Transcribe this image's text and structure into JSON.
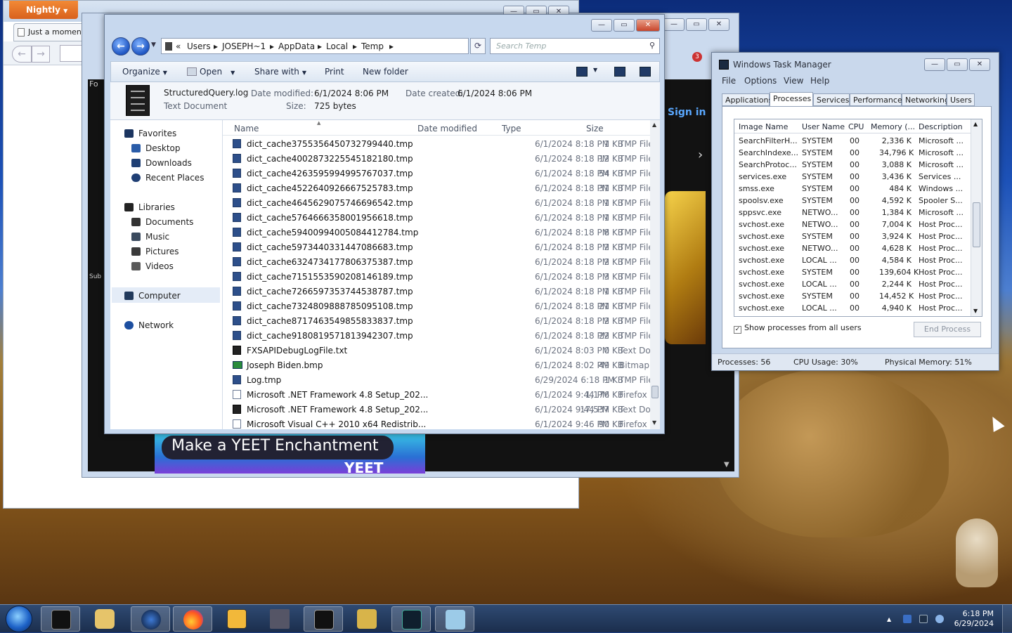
{
  "firefox": {
    "menu_button": "Nightly",
    "tab_title": "Just a moment..."
  },
  "browser": {
    "sign_in": "Sign in",
    "notification_count": "3",
    "promo_text": "Make a YEET Enchantment",
    "promo_logo": "YEET",
    "side_text_fo": "Fo",
    "side_text_sub": "Sub",
    "accent_color": "#5aa8ff"
  },
  "explorer": {
    "address": {
      "prefix": "«",
      "crumbs": [
        "Users",
        "JOSEPH~1",
        "AppData",
        "Local",
        "Temp"
      ]
    },
    "search_placeholder": "Search Temp",
    "toolbar": {
      "organize": "Organize",
      "open": "Open",
      "share_with": "Share with",
      "print": "Print",
      "new_folder": "New folder"
    },
    "details": {
      "name": "StructuredQuery.log",
      "type": "Text Document",
      "date_modified_label": "Date modified:",
      "date_modified": "6/1/2024 8:06 PM",
      "size_label": "Size:",
      "size": "725 bytes",
      "date_created_label": "Date created:",
      "date_created": "6/1/2024 8:06 PM"
    },
    "nav": {
      "favorites": "Favorites",
      "desktop": "Desktop",
      "downloads": "Downloads",
      "recent_places": "Recent Places",
      "libraries": "Libraries",
      "documents": "Documents",
      "music": "Music",
      "pictures": "Pictures",
      "videos": "Videos",
      "computer": "Computer",
      "network": "Network"
    },
    "columns": {
      "name": "Name",
      "date_modified": "Date modified",
      "type": "Type",
      "size": "Size"
    },
    "files": [
      {
        "name": "dict_cache3755356450732799440.tmp",
        "date": "6/1/2024 8:18 PM",
        "type": "TMP File",
        "size": "1 KB",
        "icon": "tmp"
      },
      {
        "name": "dict_cache4002873225545182180.tmp",
        "date": "6/1/2024 8:18 PM",
        "type": "TMP File",
        "size": "12 KB",
        "icon": "tmp"
      },
      {
        "name": "dict_cache4263595994995767037.tmp",
        "date": "6/1/2024 8:18 PM",
        "type": "TMP File",
        "size": "54 KB",
        "icon": "tmp"
      },
      {
        "name": "dict_cache4522640926667525783.tmp",
        "date": "6/1/2024 8:18 PM",
        "type": "TMP File",
        "size": "31 KB",
        "icon": "tmp"
      },
      {
        "name": "dict_cache4645629075746696542.tmp",
        "date": "6/1/2024 8:18 PM",
        "type": "TMP File",
        "size": "1 KB",
        "icon": "tmp"
      },
      {
        "name": "dict_cache5764666358001956618.tmp",
        "date": "6/1/2024 8:18 PM",
        "type": "TMP File",
        "size": "1 KB",
        "icon": "tmp"
      },
      {
        "name": "dict_cache5940099400508441278​4.tmp",
        "date": "6/1/2024 8:18 PM",
        "type": "TMP File",
        "size": "8 KB",
        "icon": "tmp"
      },
      {
        "name": "dict_cache5973440331447086683.tmp",
        "date": "6/1/2024 8:18 PM",
        "type": "TMP File",
        "size": "2 KB",
        "icon": "tmp"
      },
      {
        "name": "dict_cache6324734177806375387.tmp",
        "date": "6/1/2024 8:18 PM",
        "type": "TMP File",
        "size": "2 KB",
        "icon": "tmp"
      },
      {
        "name": "dict_cache7151553590208146189.tmp",
        "date": "6/1/2024 8:18 PM",
        "type": "TMP File",
        "size": "3 KB",
        "icon": "tmp"
      },
      {
        "name": "dict_cache7266597353744538787.tmp",
        "date": "6/1/2024 8:18 PM",
        "type": "TMP File",
        "size": "1 KB",
        "icon": "tmp"
      },
      {
        "name": "dict_cache7324809888785095108.tmp",
        "date": "6/1/2024 8:18 PM",
        "type": "TMP File",
        "size": "21 KB",
        "icon": "tmp"
      },
      {
        "name": "dict_cache8717463549855833837.tmp",
        "date": "6/1/2024 8:18 PM",
        "type": "TMP File",
        "size": "2 KB",
        "icon": "tmp"
      },
      {
        "name": "dict_cache9180819571813942307.tmp",
        "date": "6/1/2024 8:18 PM",
        "type": "TMP File",
        "size": "22 KB",
        "icon": "tmp"
      },
      {
        "name": "FXSAPIDebugLogFile.txt",
        "date": "6/1/2024 8:03 PM",
        "type": "Text Document",
        "size": "0 KB",
        "icon": "text"
      },
      {
        "name": "Joseph Biden.bmp",
        "date": "6/1/2024 8:02 PM",
        "type": "Bitmap image",
        "size": "49 KB",
        "icon": "bmp"
      },
      {
        "name": "Log.tmp",
        "date": "6/29/2024 6:18 PM",
        "type": "TMP File",
        "size": "1 KB",
        "icon": "tmp"
      },
      {
        "name": "Microsoft .NET Framework 4.8 Setup_202...",
        "date": "6/1/2024 9:44 PM",
        "type": "Firefox Document",
        "size": "1,176 KB",
        "icon": "ffdoc"
      },
      {
        "name": "Microsoft .NET Framework 4.8 Setup_202...",
        "date": "6/1/2024 9:44 PM",
        "type": "Text Document",
        "size": "17,537 KB",
        "icon": "text"
      },
      {
        "name": "Microsoft Visual C++ 2010  x64 Redistrib...",
        "date": "6/1/2024 9:46 PM",
        "type": "Firefox Document",
        "size": "90 KB",
        "icon": "ffdoc"
      }
    ]
  },
  "taskmgr": {
    "title": "Windows Task Manager",
    "menu": [
      "File",
      "Options",
      "View",
      "Help"
    ],
    "tabs": [
      "Applications",
      "Processes",
      "Services",
      "Performance",
      "Networking",
      "Users"
    ],
    "active_tab": "Processes",
    "columns": {
      "image": "Image Name",
      "user": "User Name",
      "cpu": "CPU",
      "memory": "Memory (...",
      "description": "Description"
    },
    "processes": [
      {
        "image": "SearchFilterH...",
        "user": "SYSTEM",
        "cpu": "00",
        "mem": "2,336 K",
        "desc": "Microsoft ..."
      },
      {
        "image": "SearchIndexe...",
        "user": "SYSTEM",
        "cpu": "00",
        "mem": "34,796 K",
        "desc": "Microsoft ..."
      },
      {
        "image": "SearchProtoc...",
        "user": "SYSTEM",
        "cpu": "00",
        "mem": "3,088 K",
        "desc": "Microsoft ..."
      },
      {
        "image": "services.exe",
        "user": "SYSTEM",
        "cpu": "00",
        "mem": "3,436 K",
        "desc": "Services ..."
      },
      {
        "image": "smss.exe",
        "user": "SYSTEM",
        "cpu": "00",
        "mem": "484 K",
        "desc": "Windows ..."
      },
      {
        "image": "spoolsv.exe",
        "user": "SYSTEM",
        "cpu": "00",
        "mem": "4,592 K",
        "desc": "Spooler S..."
      },
      {
        "image": "sppsvc.exe",
        "user": "NETWO...",
        "cpu": "00",
        "mem": "1,384 K",
        "desc": "Microsoft ..."
      },
      {
        "image": "svchost.exe",
        "user": "NETWO...",
        "cpu": "00",
        "mem": "7,004 K",
        "desc": "Host Proc..."
      },
      {
        "image": "svchost.exe",
        "user": "SYSTEM",
        "cpu": "00",
        "mem": "3,924 K",
        "desc": "Host Proc..."
      },
      {
        "image": "svchost.exe",
        "user": "NETWO...",
        "cpu": "00",
        "mem": "4,628 K",
        "desc": "Host Proc..."
      },
      {
        "image": "svchost.exe",
        "user": "LOCAL ...",
        "cpu": "00",
        "mem": "4,584 K",
        "desc": "Host Proc..."
      },
      {
        "image": "svchost.exe",
        "user": "SYSTEM",
        "cpu": "00",
        "mem": "139,604 K",
        "desc": "Host Proc..."
      },
      {
        "image": "svchost.exe",
        "user": "LOCAL ...",
        "cpu": "00",
        "mem": "2,244 K",
        "desc": "Host Proc..."
      },
      {
        "image": "svchost.exe",
        "user": "SYSTEM",
        "cpu": "00",
        "mem": "14,452 K",
        "desc": "Host Proc..."
      },
      {
        "image": "svchost.exe",
        "user": "LOCAL ...",
        "cpu": "00",
        "mem": "4,940 K",
        "desc": "Host Proc..."
      }
    ],
    "show_all": "Show processes from all users",
    "show_all_checked": true,
    "end_process": "End Process",
    "status": {
      "processes": "Processes: 56",
      "cpu": "CPU Usage: 30%",
      "memory": "Physical Memory: 51%"
    }
  },
  "taskbar": {
    "clock_time": "6:18 PM",
    "clock_date": "6/29/2024",
    "pinned": [
      "terminal-icon",
      "media-player-icon",
      "network-globe-icon",
      "firefox-icon",
      "de-app-icon",
      "windows-stack-icon",
      "console-icon",
      "sandbox-icon",
      "task-manager-icon",
      "paint-icon"
    ]
  }
}
